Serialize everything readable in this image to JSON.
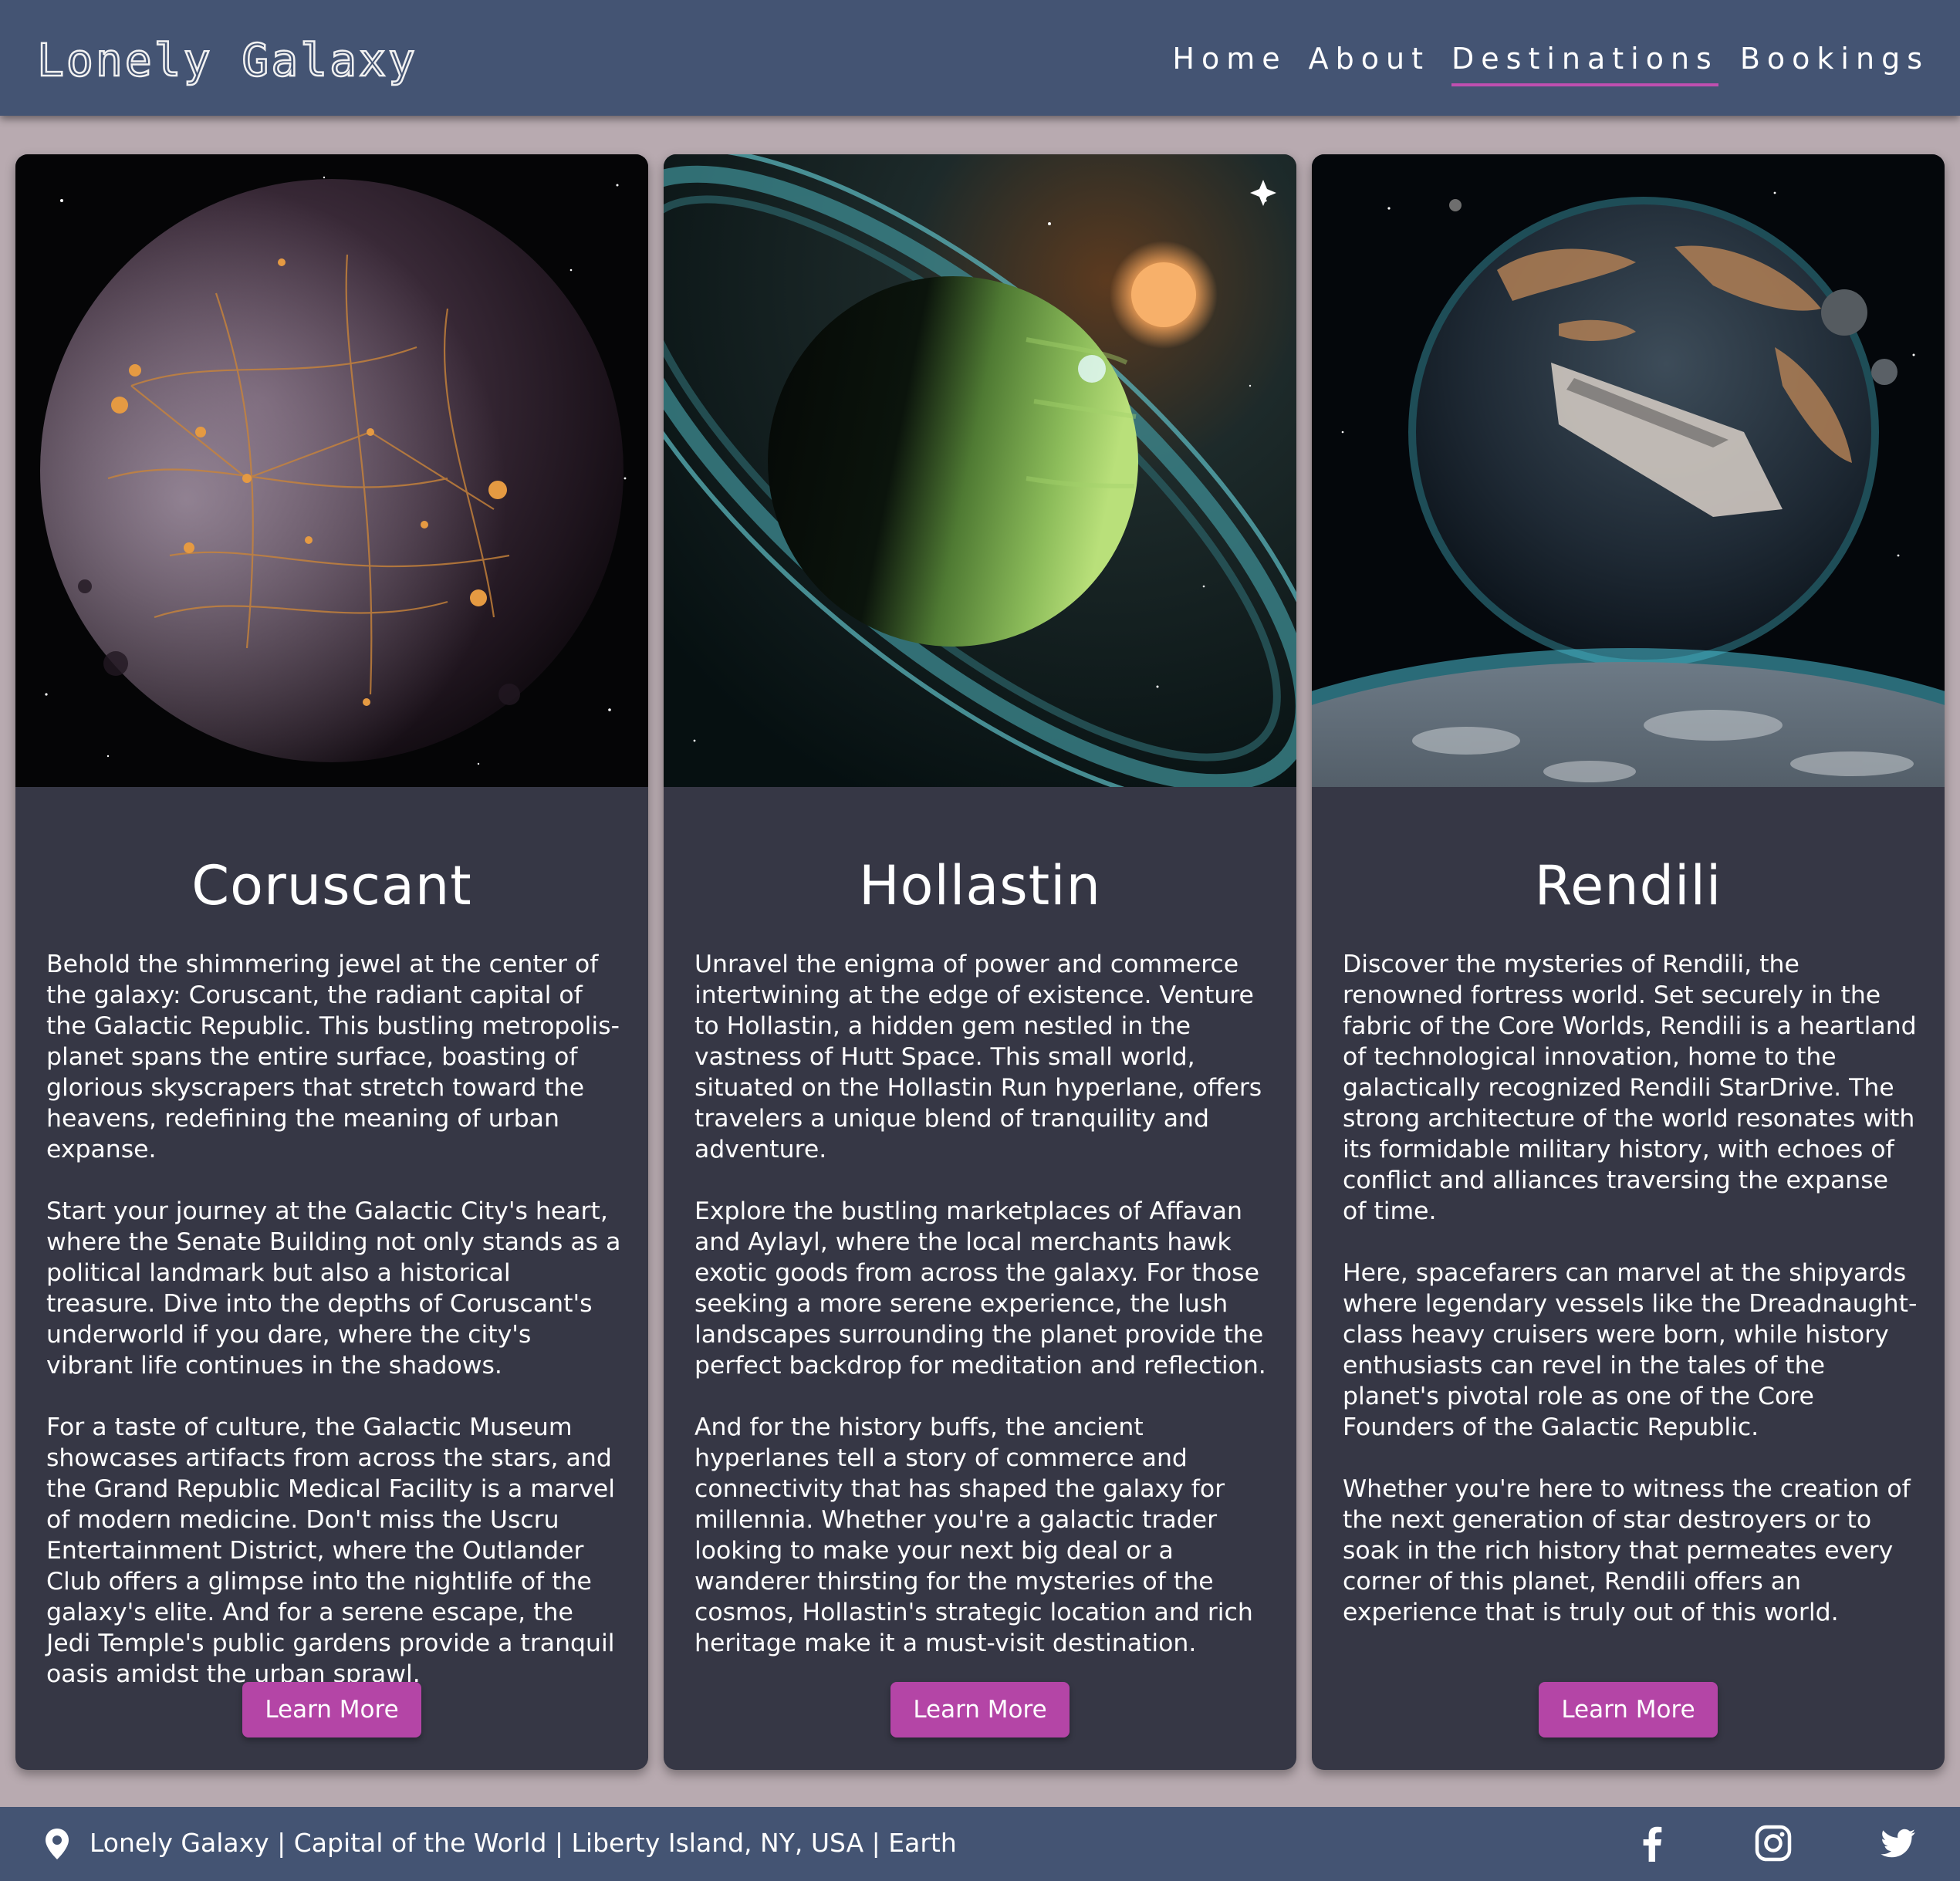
{
  "header": {
    "logo": "Lonely Galaxy",
    "nav": [
      "Home",
      "About",
      "Destinations",
      "Bookings"
    ],
    "active_nav": "Destinations"
  },
  "cards": [
    {
      "title": "Coruscant",
      "paragraphs": [
        "Behold the shimmering jewel at the center of the galaxy: Coruscant, the radiant capital of the Galactic Republic. This bustling metropolis-planet spans the entire surface, boasting of glorious skyscrapers that stretch toward the heavens, redefining the meaning of urban expanse.",
        "Start your journey at the Galactic City's heart, where the Senate Building not only stands as a political landmark but also a historical treasure. Dive into the depths of Coruscant's underworld if you dare, where the city's vibrant life continues in the shadows.",
        "For a taste of culture, the Galactic Museum showcases artifacts from across the stars, and the Grand Republic Medical Facility is a marvel of modern medicine. Don't miss the Uscru Entertainment District, where the Outlander Club offers a glimpse into the nightlife of the galaxy's elite. And for a serene escape, the Jedi Temple's public gardens provide a tranquil oasis amidst the urban sprawl."
      ],
      "button": "Learn More"
    },
    {
      "title": "Hollastin",
      "paragraphs": [
        "Unravel the enigma of power and commerce intertwining at the edge of existence. Venture to Hollastin, a hidden gem nestled in the vastness of Hutt Space. This small world, situated on the Hollastin Run hyperlane, offers travelers a unique blend of tranquility and adventure.",
        "Explore the bustling marketplaces of Affavan and Aylayl, where the local merchants hawk exotic goods from across the galaxy. For those seeking a more serene experience, the lush landscapes surrounding the planet provide the perfect backdrop for meditation and reflection.",
        "And for the history buffs, the ancient hyperlanes tell a story of commerce and connectivity that has shaped the galaxy for millennia. Whether you're a galactic trader looking to make your next big deal or a wanderer thirsting for the mysteries of the cosmos, Hollastin's strategic location and rich heritage make it a must-visit destination."
      ],
      "button": "Learn More"
    },
    {
      "title": "Rendili",
      "paragraphs": [
        "Discover the mysteries of Rendili, the renowned fortress world. Set securely in the fabric of the Core Worlds, Rendili is a heartland of technological innovation, home to the galactically recognized Rendili StarDrive. The strong architecture of the world resonates with its formidable military history, with echoes of conflict and alliances traversing the expanse of time.",
        "Here, spacefarers can marvel at the shipyards where legendary vessels like the Dreadnaught-class heavy cruisers were born, while history enthusiasts can revel in the tales of the planet's pivotal role as one of the Core Founders of the Galactic Republic.",
        "Whether you're here to witness the creation of the next generation of star destroyers or to soak in the rich history that permeates every corner of this planet, Rendili offers an experience that is truly out of this world."
      ],
      "button": "Learn More"
    }
  ],
  "footer": {
    "address": "Lonely Galaxy | Capital of the World | Liberty Island, NY, USA | Earth",
    "icons": [
      "location-pin-icon",
      "facebook-icon",
      "instagram-icon",
      "twitter-icon"
    ]
  },
  "colors": {
    "header_bg": "#445473",
    "page_bg": "#b8aab0",
    "card_bg": "#363745",
    "accent": "#b445a6"
  }
}
